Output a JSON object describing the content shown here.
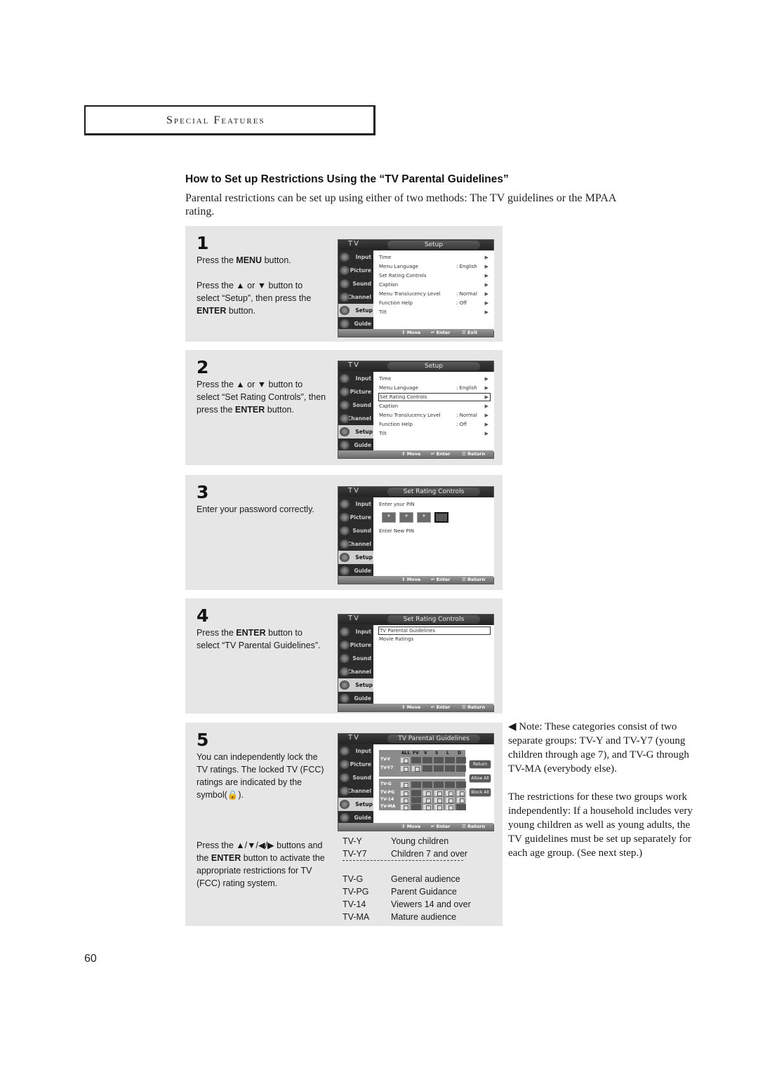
{
  "section_title": "Special Features",
  "heading": "How to Set up Restrictions Using the “TV Parental Guidelines”",
  "intro": "Parental restrictions can be set up using either of two methods: The TV guidelines or the MPAA rating.",
  "osd_common": {
    "tv_label": "TV",
    "sidebar": [
      "Input",
      "Picture",
      "Sound",
      "Channel",
      "Setup",
      "Guide"
    ],
    "active_sidebar": "Setup",
    "footer_move": "Move",
    "footer_enter": "Enter"
  },
  "steps": [
    {
      "number": "1",
      "text_html_parts": [
        "Press the ",
        "MENU",
        " button.",
        "Press the ▲ or ▼ button to select “Setup”, then press the ",
        "ENTER",
        " button."
      ],
      "osd": {
        "title": "Setup",
        "footer_exit": "Exit",
        "rows": [
          {
            "label": "Time",
            "value": "",
            "arrow": "▶"
          },
          {
            "label": "Menu Language",
            "value": ": English",
            "arrow": "▶"
          },
          {
            "label": "Set Rating Controls",
            "value": "",
            "arrow": "▶"
          },
          {
            "label": "Caption",
            "value": "",
            "arrow": "▶"
          },
          {
            "label": "Menu Translucency Level",
            "value": ": Normal",
            "arrow": "▶"
          },
          {
            "label": "Function Help",
            "value": ": Off",
            "arrow": "▶"
          },
          {
            "label": "Tilt",
            "value": "",
            "arrow": "▶"
          }
        ]
      }
    },
    {
      "number": "2",
      "text_html_parts": [
        "Press the ▲ or ▼ button to select “Set Rating Controls”, then press the ",
        "ENTER",
        " button."
      ],
      "osd": {
        "title": "Setup",
        "footer_exit": "Return",
        "selected_row": "Set Rating Controls",
        "rows": [
          {
            "label": "Time",
            "value": "",
            "arrow": "▶"
          },
          {
            "label": "Menu Language",
            "value": ": English",
            "arrow": "▶"
          },
          {
            "label": "Set Rating Controls",
            "value": "",
            "arrow": "▶"
          },
          {
            "label": "Caption",
            "value": "",
            "arrow": "▶"
          },
          {
            "label": "Menu Translucency Level",
            "value": ": Normal",
            "arrow": "▶"
          },
          {
            "label": "Function Help",
            "value": ": Off",
            "arrow": "▶"
          },
          {
            "label": "Tilt",
            "value": "",
            "arrow": "▶"
          }
        ]
      }
    },
    {
      "number": "3",
      "text": "Enter your password correctly.",
      "osd": {
        "title": "Set Rating Controls",
        "footer_exit": "Return",
        "pin_label": "Enter your PIN",
        "pin_digits": [
          "*",
          "*",
          "*",
          ""
        ],
        "new_pin_label": "Enter New PIN"
      }
    },
    {
      "number": "4",
      "text_html_parts": [
        "Press the ",
        "ENTER",
        " button to select “TV Parental Guidelines”."
      ],
      "osd": {
        "title": "Set Rating Controls",
        "footer_exit": "Return",
        "selected_row": "TV Parental Guidelines",
        "rows": [
          "TV Parental Guidelines",
          "Movie Ratings"
        ]
      }
    },
    {
      "number": "5",
      "text": "You can independently lock the TV ratings. The locked TV (FCC) ratings are indicated by the symbol(🔒).",
      "text2_parts": [
        "Press the ▲/▼/◀/▶ buttons and the ",
        "ENTER",
        " button to activate the appropriate restrictions for TV (FCC) rating system."
      ],
      "osd": {
        "title": "TV Parental Guidelines",
        "footer_exit": "Return",
        "columns": [
          "ALL",
          "FV",
          "V",
          "S",
          "L",
          "D"
        ],
        "rows": [
          {
            "label": "TV-Y",
            "locks": [
              true,
              false,
              false,
              false,
              false,
              false
            ]
          },
          {
            "label": "TV-Y7",
            "locks": [
              true,
              true,
              false,
              false,
              false,
              false
            ]
          },
          {
            "label": "TV-G",
            "locks": [
              true,
              false,
              false,
              false,
              false,
              false
            ]
          },
          {
            "label": "TV-PG",
            "locks": [
              true,
              false,
              true,
              true,
              true,
              true
            ]
          },
          {
            "label": "TV-14",
            "locks": [
              true,
              false,
              true,
              true,
              true,
              true
            ]
          },
          {
            "label": "TV-MA",
            "locks": [
              true,
              false,
              true,
              true,
              true,
              false
            ]
          }
        ],
        "buttons": [
          "Return",
          "Allow All",
          "Block All"
        ]
      },
      "ratings": [
        {
          "code": "TV-Y",
          "desc": "Young children"
        },
        {
          "code": "TV-Y7",
          "desc": "Children 7 and over"
        },
        {
          "code": "TV-G",
          "desc": "General audience"
        },
        {
          "code": "TV-PG",
          "desc": "Parent Guidance"
        },
        {
          "code": "TV-14",
          "desc": "Viewers 14 and over"
        },
        {
          "code": "TV-MA",
          "desc": "Mature audience"
        }
      ]
    }
  ],
  "note": {
    "p1": "◀ Note: These categories consist of two separate groups: TV-Y and TV-Y7 (young children through age 7), and TV-G through TV-MA (everybody else).",
    "p2": "The restrictions for these two groups work independently: If a household includes very young children as well as young adults, the TV guidelines must be set up separately for each age group. (See next step.)"
  },
  "page_number": "60"
}
